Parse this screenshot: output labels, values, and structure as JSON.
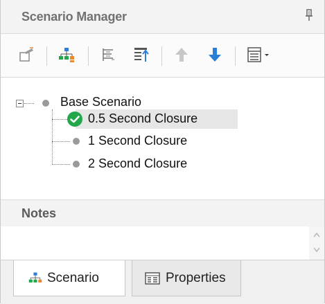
{
  "panel": {
    "title": "Scenario Manager"
  },
  "toolbar": {
    "buttons": [
      {
        "icon": "new-scenario-icon"
      },
      {
        "icon": "scenario-tree-icon"
      },
      {
        "icon": "collapse-tree-icon"
      },
      {
        "icon": "sort-icon"
      },
      {
        "icon": "move-up-icon"
      },
      {
        "icon": "move-down-icon"
      },
      {
        "icon": "view-options-icon"
      }
    ]
  },
  "tree": {
    "nodes": [
      {
        "label": "Base Scenario"
      },
      {
        "label": "0.5 Second Closure",
        "current": true
      },
      {
        "label": "1 Second Closure"
      },
      {
        "label": "2 Second Closure"
      }
    ]
  },
  "notes": {
    "label": "Notes"
  },
  "tabs": [
    {
      "label": "Scenario",
      "active": true
    },
    {
      "label": "Properties",
      "active": false
    }
  ],
  "colors": {
    "accent_blue": "#2b7fd6",
    "check_green": "#22a84a",
    "orange": "#e8892b"
  }
}
